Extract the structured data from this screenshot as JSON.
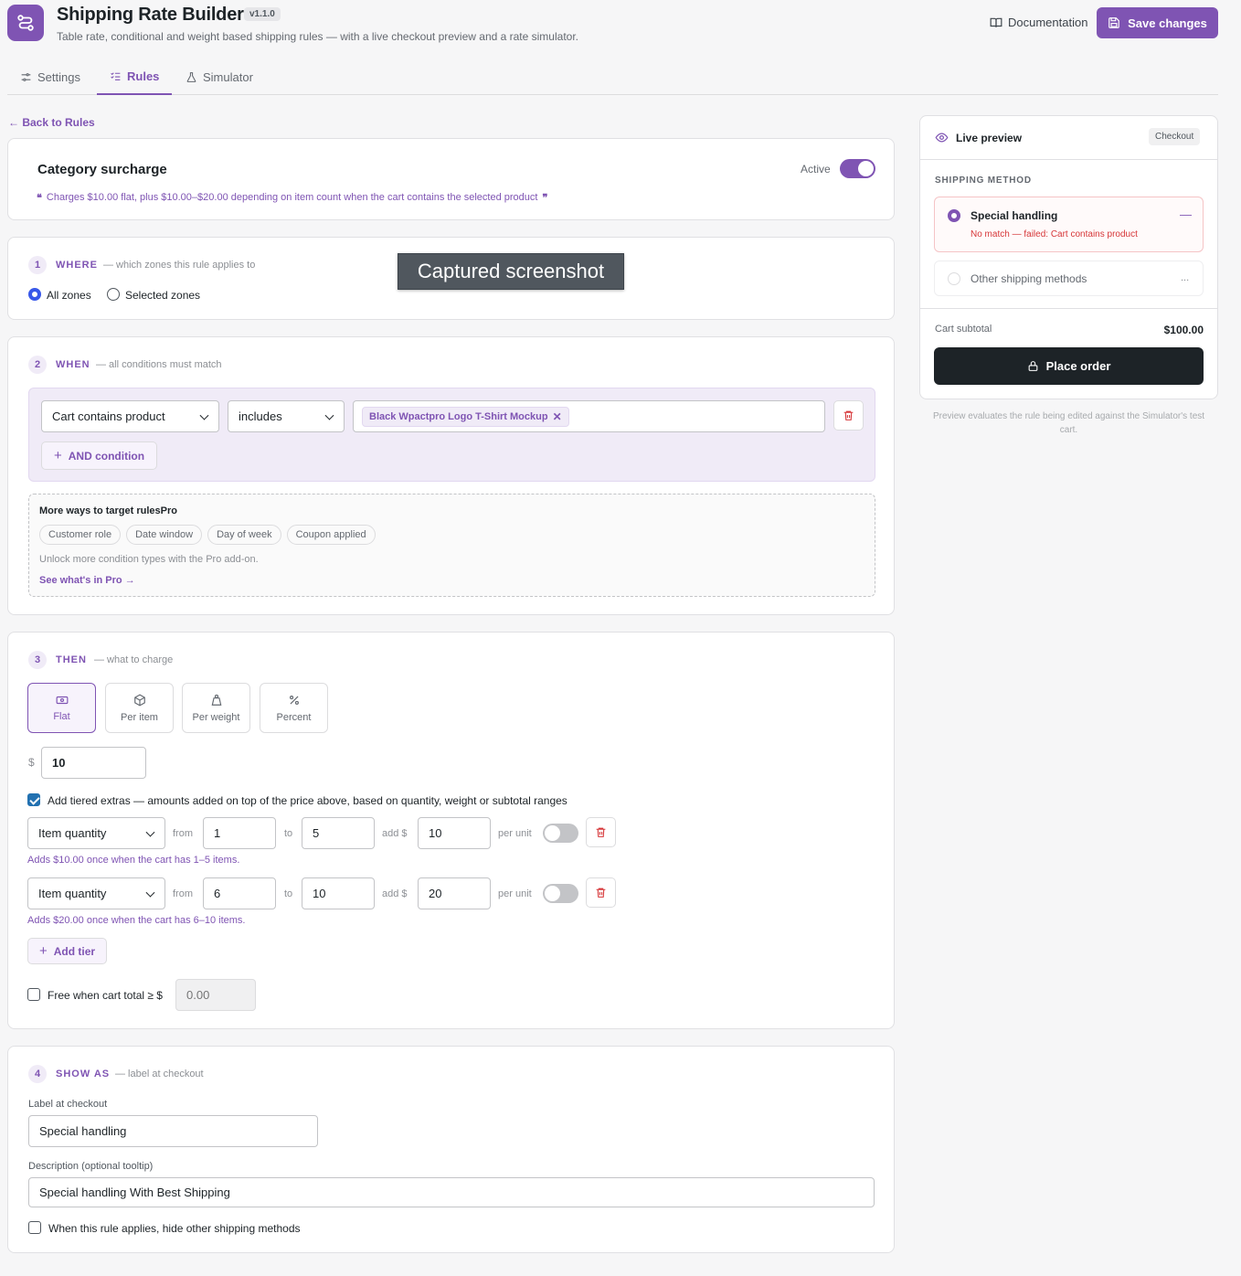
{
  "header": {
    "title": "Shipping Rate Builder",
    "version": "v1.1.0",
    "subtitle": "Table rate, conditional and weight based shipping rules — with a live checkout preview and a rate simulator.",
    "documentation_label": "Documentation",
    "save_label": "Save changes"
  },
  "tabs": [
    {
      "label": "Settings",
      "icon": "sliders-icon"
    },
    {
      "label": "Rules",
      "icon": "list-check-icon"
    },
    {
      "label": "Simulator",
      "icon": "flask-icon"
    }
  ],
  "active_tab": "Rules",
  "back_label": "← Back to Rules",
  "rule": {
    "name": "Category surcharge",
    "active_label": "Active",
    "active": true,
    "summary": "Charges $10.00 flat, plus $10.00–$20.00 depending on item count when the cart contains the selected product"
  },
  "where": {
    "num": "1",
    "title": "WHERE",
    "sub": "— which zones this rule applies to",
    "options": [
      "All zones",
      "Selected zones"
    ],
    "selected": "All zones"
  },
  "when": {
    "num": "2",
    "title": "WHEN",
    "sub": "— all conditions must match",
    "condition_type": "Cart contains product",
    "operator": "includes",
    "product_tag": "Black Wpactpro Logo T-Shirt Mockup",
    "add_condition_label": "AND condition",
    "pro": {
      "title": "More ways to target rulesPro",
      "chips": [
        "Customer role",
        "Date window",
        "Day of week",
        "Coupon applied"
      ],
      "note": "Unlock more condition types with the Pro add-on.",
      "link": "See what's in Pro →"
    }
  },
  "then": {
    "num": "3",
    "title": "THEN",
    "sub": "— what to charge",
    "types": [
      "Flat",
      "Per item",
      "Per weight",
      "Percent"
    ],
    "selected_type": "Flat",
    "currency": "$",
    "amount": "10",
    "tiered_label": "Add tiered extras — amounts added on top of the price above, based on quantity, weight or subtotal ranges",
    "tiered_enabled": true,
    "tier_words": {
      "from": "from",
      "to": "to",
      "add": "add $",
      "per_unit": "per unit"
    },
    "tiers": [
      {
        "basis": "Item quantity",
        "from": "1",
        "to": "5",
        "add": "10",
        "per_unit": false,
        "note": "Adds $10.00 once when the cart has 1–5 items."
      },
      {
        "basis": "Item quantity",
        "from": "6",
        "to": "10",
        "add": "20",
        "per_unit": false,
        "note": "Adds $20.00 once when the cart has 6–10 items."
      }
    ],
    "add_tier_label": "Add tier",
    "free_label": "Free when cart total ≥ $",
    "free_placeholder": "0.00",
    "free_enabled": false
  },
  "show_as": {
    "num": "4",
    "title": "SHOW AS",
    "sub": "— label at checkout",
    "label_title": "Label at checkout",
    "label_value": "Special handling",
    "desc_title": "Description (optional tooltip)",
    "desc_value": "Special handling With Best Shipping",
    "hide_label": "When this rule applies, hide other shipping methods",
    "hide_enabled": false
  },
  "preview": {
    "title": "Live preview",
    "badge": "Checkout",
    "section_label": "SHIPPING METHOD",
    "methods": [
      {
        "name": "Special handling",
        "status": "No match — failed: Cart contains product",
        "value": "—",
        "selected": true
      },
      {
        "name": "Other shipping methods",
        "value": "...",
        "selected": false
      }
    ],
    "subtotal_label": "Cart subtotal",
    "subtotal_value": "$100.00",
    "place_order_label": "Place order",
    "footnote": "Preview evaluates the rule being edited against the Simulator's test cart."
  },
  "overlay_label": "Captured screenshot",
  "colors": {
    "accent": "#7f54b3",
    "danger": "#d63638",
    "dark": "#1d2327",
    "radio_blue": "#3858e9"
  }
}
